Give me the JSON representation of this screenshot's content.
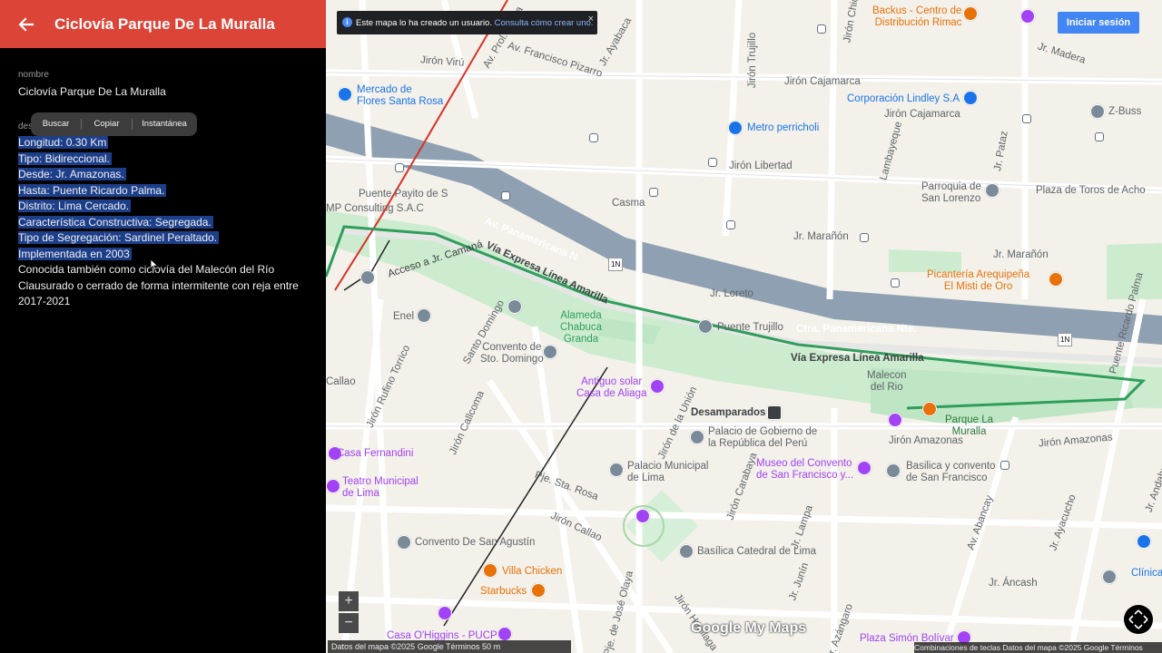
{
  "panel": {
    "title": "Ciclovía Parque De La Muralla",
    "name_label": "nombre",
    "name_value": "Ciclovía Parque De La Muralla",
    "desc_label": "descripción",
    "desc_label_visible": "des",
    "context_menu": {
      "search": "Buscar",
      "copy": "Copiar",
      "snapshot": "Instantánea"
    },
    "description_lines": [
      {
        "text": "Longitud: 0.30 Km",
        "selected": true
      },
      {
        "text": "Tipo: Bidireccional.",
        "selected": true
      },
      {
        "text": "Desde: Jr. Amazonas.",
        "selected": true
      },
      {
        "text": "Hasta: Puente Ricardo Palma.",
        "selected": true
      },
      {
        "text": "Distrito: Lima Cercado.",
        "selected": true
      },
      {
        "text": "Característica Constructiva: Segregada.",
        "selected": true
      },
      {
        "text": "Tipo de Segregación: Sardinel Peraltado.",
        "selected": true
      },
      {
        "text": "Implementada en 2003",
        "selected": true
      },
      {
        "text": "Conocida también como ciclovía del Malecón del Río",
        "selected": false
      },
      {
        "text": "Clausurado o cerrado de forma intermitente con reja entre",
        "selected": false
      },
      {
        "text": "2017-2021",
        "selected": false
      }
    ]
  },
  "map": {
    "banner": {
      "text": "Este mapa lo ha creado un usuario.",
      "link": "Consulta cómo crear uno.",
      "close": "×"
    },
    "signin": "Iniciar sesión",
    "zoom_in": "+",
    "zoom_out": "−",
    "attribution_left": "Datos del mapa ©2025 Google   Términos   50 m",
    "attribution_right": "Combinaciones de teclas   Datos del mapa ©2025 Google   Términos",
    "logo": "Google My Maps",
    "colors": {
      "header_red": "#db4437",
      "selection": "#1d3f8a",
      "highway": "#8fa0b2",
      "cycleway": "#2f9e5b",
      "park": "#cdeccf",
      "water": "#aadaff"
    },
    "labels": {
      "jiron_viru": "Jirón Virú",
      "av_prol_tacna": "Av. Prol. Tacna",
      "av_francisco_pizarro": "Av. Francisco Pizarro",
      "jr_ayabaca": "Jr. Ayabaca",
      "jiron_trujillo": "Jirón Trujillo",
      "jiron_chiclayo": "Jirón Chiclayo",
      "backus": "Backus - Centro de\nDistribución Rimac",
      "jr_madera": "Jr. Madera",
      "mercado": "Mercado de\nFlores Santa Rosa",
      "jiron_cajamarca": "Jirón Cajamarca",
      "lindley": "Corporación Lindley S.A",
      "z_buss": "Z-Buss",
      "jiron_cajamarca2": "Jirón Cajamarca",
      "metro": "Metro perricholi",
      "jiron_libertad": "Jirón Libertad",
      "lambayeque": "Lambayeque",
      "jr_pataz": "Jr. Pataz",
      "parroquia": "Parroquia de\nSan Lorenzo",
      "plaza_toros": "Plaza de Toros de Acho",
      "puente_payito": "Puente Payito de S",
      "mp_consulting": "MP Consulting S.A.C",
      "casma": "Casma",
      "av_panamericana_n": "Av. Panamericana N",
      "jr_maranon": "Jr. Marañón",
      "jr_maranon2": "Jr. Marañón",
      "acceso_camana": "Acceso a Jr. Camaná",
      "via_expresa": "Vía Expresa Línea Amarilla",
      "picanteria": "Picantería Arequipeña\nEl Misti de Oro",
      "jr_loreto": "Jr. Loreto",
      "enel": "Enel",
      "chabuca": "Alameda\nChabuca\nGranda",
      "santo_domingo": "Santo Domingo",
      "convento_sto_domingo": "Convento de\nSto. Domingo",
      "puente_trujillo": "Puente Trujillo",
      "ctra_panamericana": "Ctra. Panamericana Nte.",
      "via_expresa2": "Vía Expresa Línea Amarilla",
      "malecon": "Malecon\ndel Rio",
      "ricardo_palma": "Puente Ricardo Palma",
      "callao": "Callao",
      "rufino_torrico": "Jirón Rufino Torrico",
      "jiron_callcoma": "Jirón Callcoma",
      "antiguo_solar": "Antiguo solar\nCasa de Aliaga",
      "jiron_union": "Jirón de la Unión",
      "desamparados": "Desamparados",
      "palacio_gobierno": "Palacio de Gobierno de\nla República del Perú",
      "parque_muralla": "Parque La\nMuralla",
      "jiron_amazonas": "Jirón Amazonas",
      "jiron_amazonas2": "Jirón Amazonas",
      "casa_fernandini": "Casa Fernandini",
      "teatro": "Teatro Municipal\nde Lima",
      "pje_santa_rosa": "Pje. Sta. Rosa",
      "palacio_municipal": "Palacio Municipal\nde Lima",
      "jiron_carabaya": "Jirón Carabaya",
      "museo_convento": "Museo del Convento\nde San Francisco y...",
      "basilica_convento": "Basilica y convento\nde San Francisco",
      "jiron_callao": "Jirón Callao",
      "convento_san_agustin": "Convento De San Agustín",
      "basilica_catedral": "Basílica Catedral de Lima",
      "jr_lampa": "Jr. Lampa",
      "av_abancay": "Av. Abancay",
      "jr_ayacucho": "Jr. Ayacucho",
      "jr_andahuaylas": "Jr. Andahuaylas",
      "clinica": "Clínica",
      "villa_chicken": "Villa Chicken",
      "starbucks": "Starbucks",
      "pje_olaya": "Pje. de José Olaya",
      "jiron_huallaga": "Jirón Huallaga",
      "jr_junin": "Jr. Junín",
      "jr_ancash": "Jr. Áncash",
      "jr_azangaro": "Jr. Azángaro",
      "casa_ohiggins": "Casa O'Higgins - PUCP",
      "plaza_simon": "Plaza Simón Bolívar",
      "shield_1n": "1N",
      "shield_1n2": "1N"
    }
  }
}
